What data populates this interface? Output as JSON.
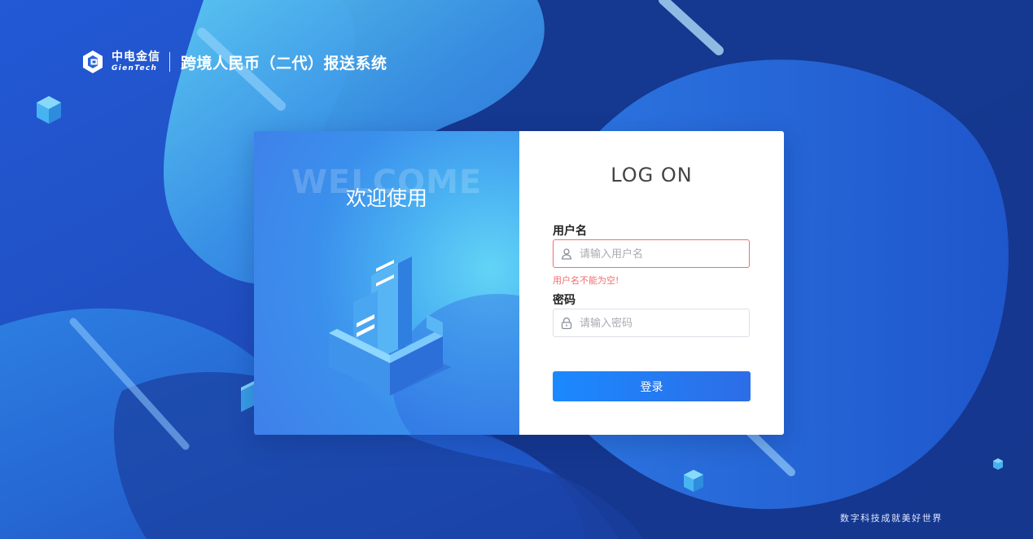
{
  "header": {
    "brand_cn": "中电金信",
    "brand_en": "GienTech",
    "system_title": "跨境人民币（二代）报送系统"
  },
  "welcome": {
    "watermark": "WELCOME",
    "title": "欢迎使用"
  },
  "login": {
    "title": "LOG ON",
    "username_label": "用户名",
    "username_placeholder": "请输入用户名",
    "username_value": "",
    "username_error": "用户名不能为空!",
    "password_label": "密码",
    "password_placeholder": "请输入密码",
    "password_value": "",
    "submit_label": "登录"
  },
  "footer": {
    "slogan": "数字科技成就美好世界"
  },
  "colors": {
    "primary_button": "#1b89ff",
    "error": "#f56c6c",
    "background": "#1e4fc2"
  },
  "icons": {
    "username": "user-icon",
    "password": "lock-icon",
    "brand": "gientech-logo-icon"
  }
}
